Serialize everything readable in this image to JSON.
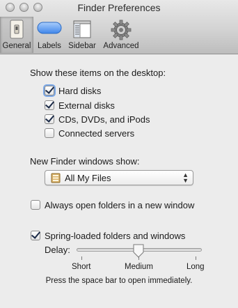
{
  "window": {
    "title": "Finder Preferences"
  },
  "toolbar": {
    "items": [
      {
        "label": "General",
        "selected": true
      },
      {
        "label": "Labels",
        "selected": false
      },
      {
        "label": "Sidebar",
        "selected": false
      },
      {
        "label": "Advanced",
        "selected": false
      }
    ]
  },
  "desktop": {
    "heading": "Show these items on the desktop:",
    "items": [
      {
        "label": "Hard disks",
        "checked": true
      },
      {
        "label": "External disks",
        "checked": true
      },
      {
        "label": "CDs, DVDs, and iPods",
        "checked": true
      },
      {
        "label": "Connected servers",
        "checked": false
      }
    ]
  },
  "new_window": {
    "heading": "New Finder windows show:",
    "selected": "All My Files"
  },
  "always_open": {
    "label": "Always open folders in a new window",
    "checked": false
  },
  "spring_loaded": {
    "label": "Spring-loaded folders and windows",
    "checked": true,
    "delay_label": "Delay:",
    "delay_value": "Medium",
    "ticks": [
      "Short",
      "Medium",
      "Long"
    ],
    "hint": "Press the space bar to open immediately."
  },
  "colors": {
    "labels_icon": "#5b9bf2",
    "check": "#1b2a47"
  }
}
